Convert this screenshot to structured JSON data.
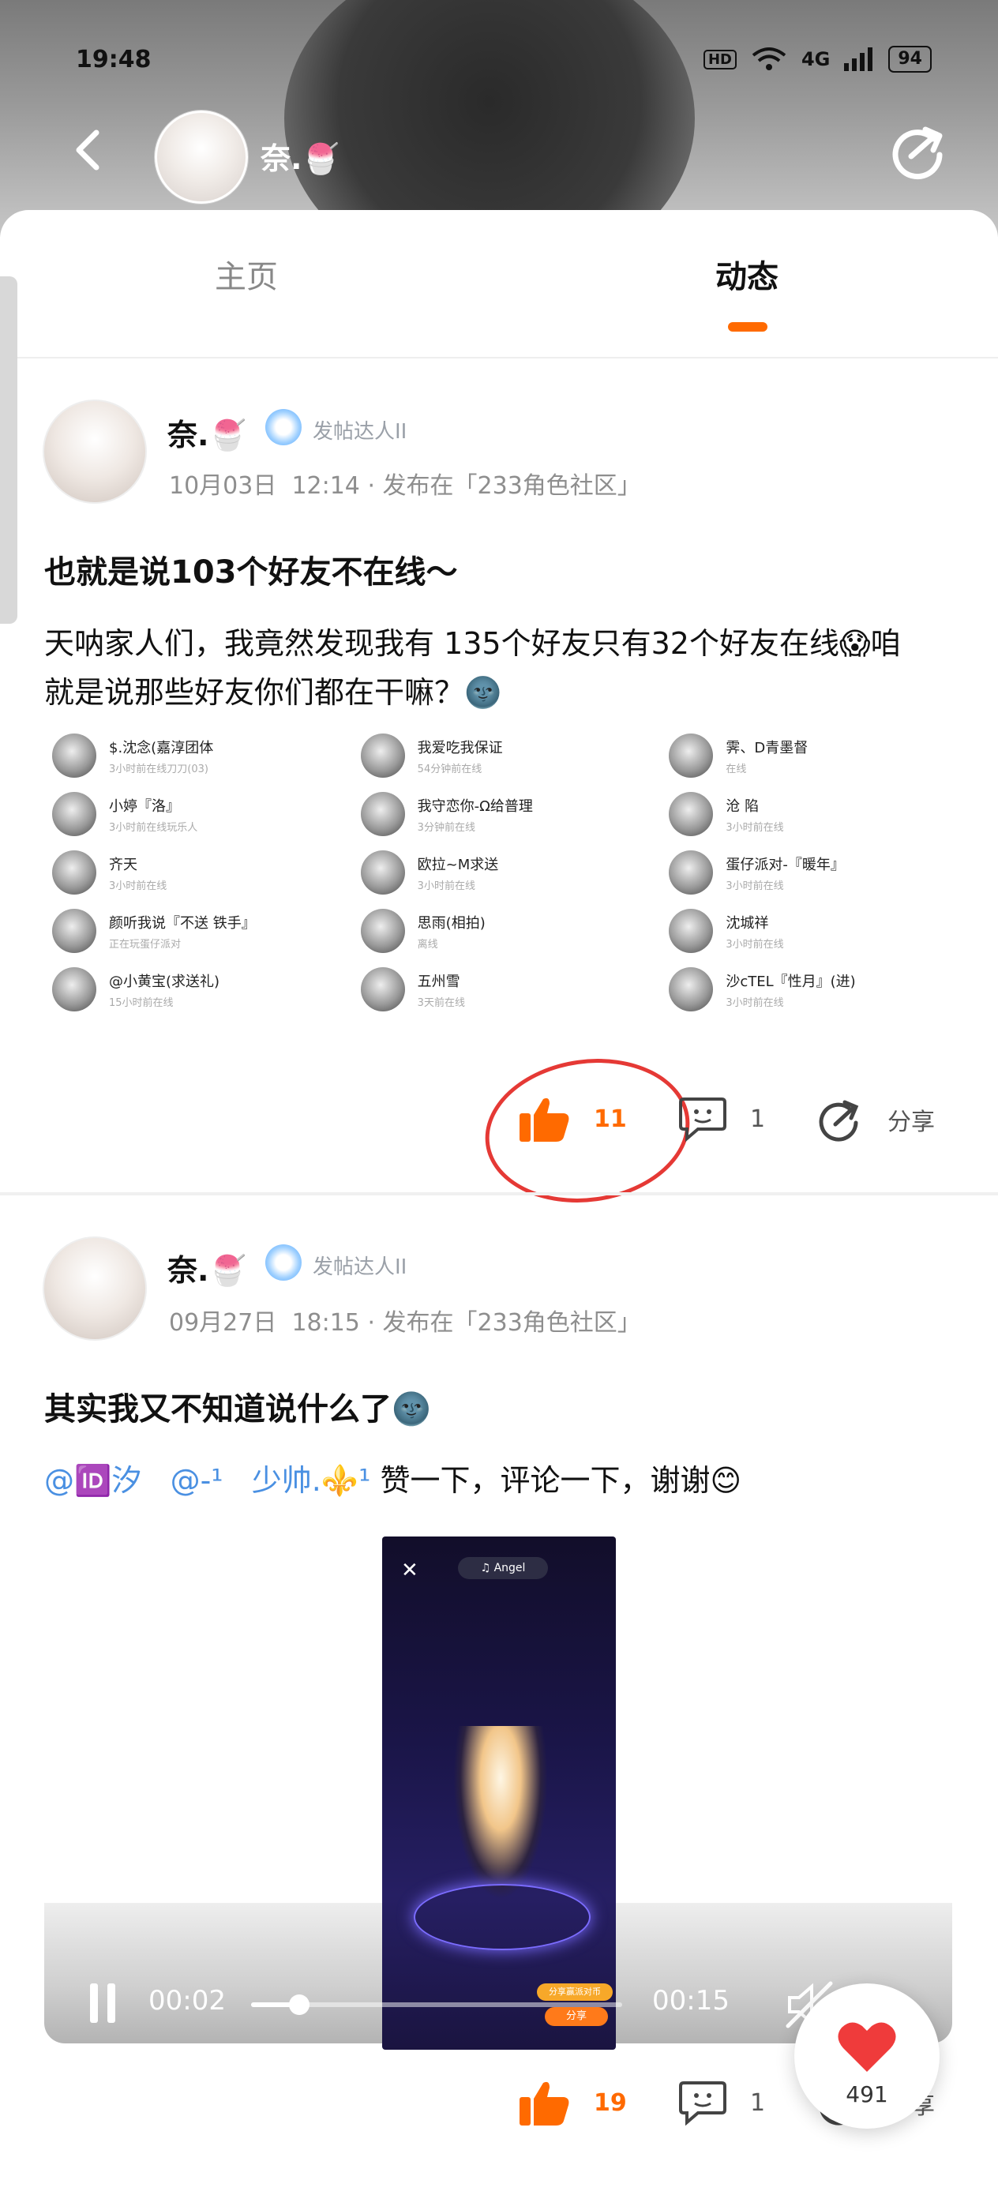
{
  "status_bar": {
    "time": "19:48",
    "hd": "HD",
    "network": "4G",
    "battery": "94"
  },
  "header": {
    "username": "奈.",
    "username_emoji": "🍧"
  },
  "tabs": {
    "home": "主页",
    "feed": "动态"
  },
  "posts": [
    {
      "author": "奈.",
      "author_emoji": "🍧",
      "badge": "发帖达人II",
      "date": "10月03日",
      "time": "12:14",
      "posted_in": "发布在「233角色社区」",
      "title": "也就是说103个好友不在线～",
      "body_line1": "天呐家人们，我竟然发现我有 135个好友只有32个好友在线😱咱",
      "body_line2": "就是说那些好友你们都在干嘛？🌚",
      "likes": "11",
      "comments": "1",
      "share_label": "分享",
      "screenshots": [
        {
          "rows": [
            {
              "name": "$.沈念(嘉淳团体",
              "sub": "3小时前在线刀刀(03)"
            },
            {
              "name": "小婷『洛』",
              "sub": "3小时前在线玩乐人"
            },
            {
              "name": "齐天",
              "sub": "3小时前在线"
            },
            {
              "name": "颜听我说『不送 铁手』",
              "sub": "正在玩蛋仔派对"
            },
            {
              "name": "@小黄宝(求送礼)",
              "sub": "15小时前在线"
            }
          ]
        },
        {
          "rows": [
            {
              "name": "我爱吃我保证",
              "sub": "54分钟前在线"
            },
            {
              "name": "我守恋你-Ω给普理",
              "sub": "3分钟前在线"
            },
            {
              "name": "欧拉~M求送",
              "sub": "3小时前在线"
            },
            {
              "name": "思雨(相拍)",
              "sub": "离线"
            },
            {
              "name": "五州雪",
              "sub": "3天前在线"
            }
          ]
        },
        {
          "rows": [
            {
              "name": "霁、D青墨督",
              "sub": "在线"
            },
            {
              "name": "沧 陷",
              "sub": "3小时前在线"
            },
            {
              "name": "蛋仔派对-『暖年』",
              "sub": "3小时前在线"
            },
            {
              "name": "沈城祥",
              "sub": "3小时前在线"
            },
            {
              "name": "沙cTEL『性月』(进)",
              "sub": "3小时前在线"
            }
          ]
        }
      ]
    },
    {
      "author": "奈.",
      "author_emoji": "🍧",
      "badge": "发帖达人II",
      "date": "09月27日",
      "time": "18:15",
      "posted_in": "发布在「233角色社区」",
      "title": "其实我又不知道说什么了🌚",
      "mention1": "@🆔汐",
      "mention2": "@-¹",
      "mention3": "少帅.⚜️¹",
      "body_rest": "赞一下，评论一下，谢谢😊",
      "likes": "19",
      "comments": "1",
      "share_label": "分享",
      "video": {
        "current": "00:02",
        "duration": "00:15",
        "progress": 0.13,
        "music_chip": "♫ Angel",
        "share_tip": "分享赢派对币",
        "share_btn": "分享"
      }
    }
  ],
  "like_fab": {
    "count": "491"
  },
  "colors": {
    "accent": "#ff6a00",
    "mention": "#4a90e2",
    "annotation_red": "#e53935"
  }
}
